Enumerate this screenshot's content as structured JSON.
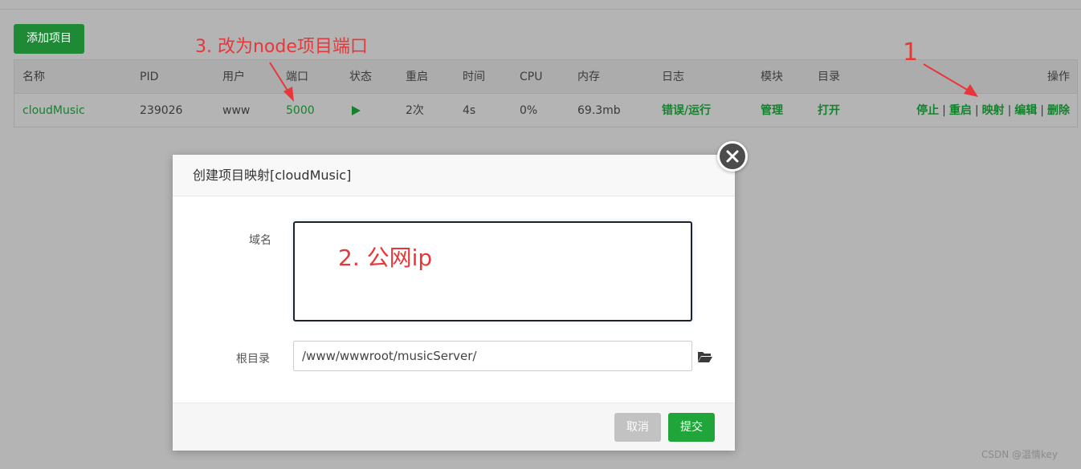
{
  "toolbar": {
    "add_project": "添加项目"
  },
  "table": {
    "headers": [
      "名称",
      "PID",
      "用户",
      "端口",
      "状态",
      "重启",
      "时间",
      "CPU",
      "内存",
      "日志",
      "模块",
      "目录",
      "操作"
    ],
    "row": {
      "name": "cloudMusic",
      "pid": "239026",
      "user": "www",
      "port": "5000",
      "status_icon": "play-icon",
      "restarts": "2次",
      "time": "4s",
      "cpu": "0%",
      "memory": "69.3mb",
      "log": "错误/运行",
      "module": "管理",
      "directory": "打开",
      "actions": [
        "停止",
        "重启",
        "映射",
        "编辑",
        "删除"
      ],
      "action_separator": "|"
    }
  },
  "annotations": {
    "step1": "1",
    "step2": "2. 公网ip",
    "step3": "3. 改为node项目端口",
    "color": "#e8373a"
  },
  "modal": {
    "title": "创建项目映射[cloudMusic]",
    "domain_label": "域名",
    "root_label": "根目录",
    "root_value": "/www/wwwroot/musicServer/",
    "cancel": "取消",
    "submit": "提交",
    "close_icon": "close-icon",
    "folder_icon": "folder-open-icon"
  },
  "watermark": "CSDN @温情key",
  "colors": {
    "accent_green": "#20a53a",
    "link_green": "#14822d",
    "cancel_gray": "#c2c2c2"
  }
}
